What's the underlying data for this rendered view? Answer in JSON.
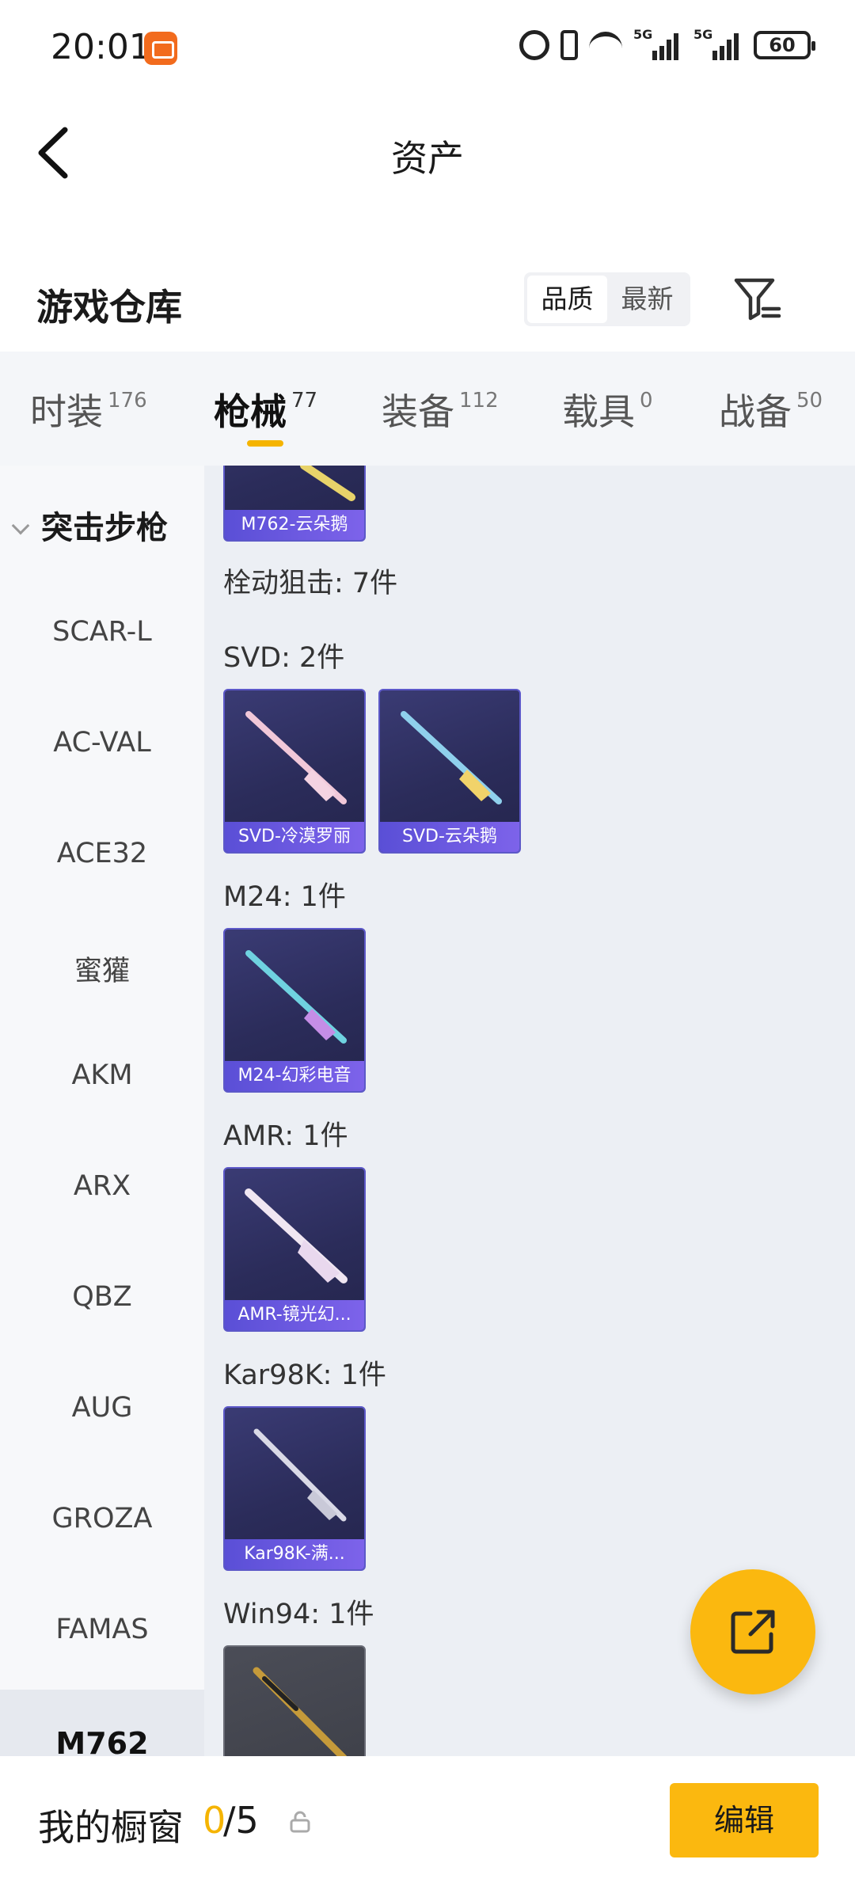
{
  "status_bar": {
    "time": "20:01",
    "signal1_label": "5G",
    "signal2_label": "5G",
    "battery": "60"
  },
  "header": {
    "title": "资产"
  },
  "warehouse": {
    "title": "游戏仓库",
    "sort_options": [
      "品质",
      "最新"
    ],
    "active_sort": "品质"
  },
  "tabs": [
    {
      "label": "时装",
      "count": "176"
    },
    {
      "label": "枪械",
      "count": "77"
    },
    {
      "label": "装备",
      "count": "112"
    },
    {
      "label": "载具",
      "count": "0"
    },
    {
      "label": "战备",
      "count": "50"
    }
  ],
  "sidebar": {
    "group": "突击步枪",
    "items": [
      "SCAR-L",
      "AC-VAL",
      "ACE32",
      "蜜獾",
      "AKM",
      "ARX",
      "QBZ",
      "AUG",
      "GROZA",
      "FAMAS"
    ],
    "active_item": "M762"
  },
  "content": {
    "top_card_label": "M762-云朵鹅",
    "section_title": "栓动狙击: 7件",
    "groups": [
      {
        "title": "SVD: 2件",
        "items": [
          "SVD-冷漠罗丽",
          "SVD-云朵鹅"
        ]
      },
      {
        "title": "M24: 1件",
        "items": [
          "M24-幻彩电音"
        ]
      },
      {
        "title": "AMR: 1件",
        "items": [
          "AMR-镜光幻..."
        ]
      },
      {
        "title": "Kar98K: 1件",
        "items": [
          "Kar98K-满..."
        ]
      },
      {
        "title": "Win94: 1件",
        "items": [
          ""
        ]
      }
    ]
  },
  "bottom_bar": {
    "showcase_label": "我的橱窗",
    "showcase_used": "0",
    "showcase_total": "/5",
    "edit_label": "编辑"
  },
  "colors": {
    "accent": "#fbb80f",
    "card_bg": "#2b2c5a",
    "card_label_bg": "#6a58e0"
  }
}
